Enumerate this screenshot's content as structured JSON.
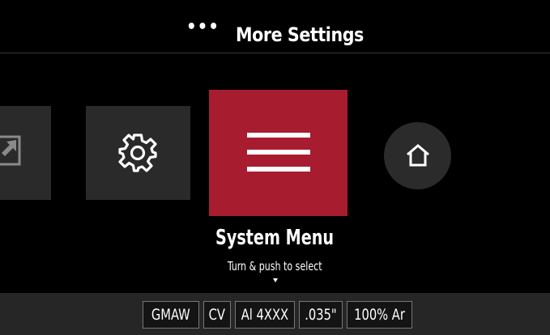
{
  "header": {
    "more_icon": "ellipsis-icon",
    "title": "More Settings"
  },
  "carousel": {
    "tiles": [
      {
        "name": "partial-tile",
        "icon": "export-icon"
      },
      {
        "name": "settings-tile",
        "icon": "gear-icon"
      },
      {
        "name": "system-menu-tile",
        "icon": "hamburger-menu-icon",
        "selected": true
      },
      {
        "name": "home-tile",
        "icon": "home-icon"
      }
    ],
    "selected_label": "System Menu",
    "hint": "Turn & push to select"
  },
  "status": {
    "chips": [
      "GMAW",
      "CV",
      "Al 4XXX",
      ".035\"",
      "100% Ar"
    ]
  },
  "colors": {
    "accent": "#a81c2f",
    "background": "#000000",
    "tile": "#2a2a2a",
    "statusbar": "#262626"
  }
}
